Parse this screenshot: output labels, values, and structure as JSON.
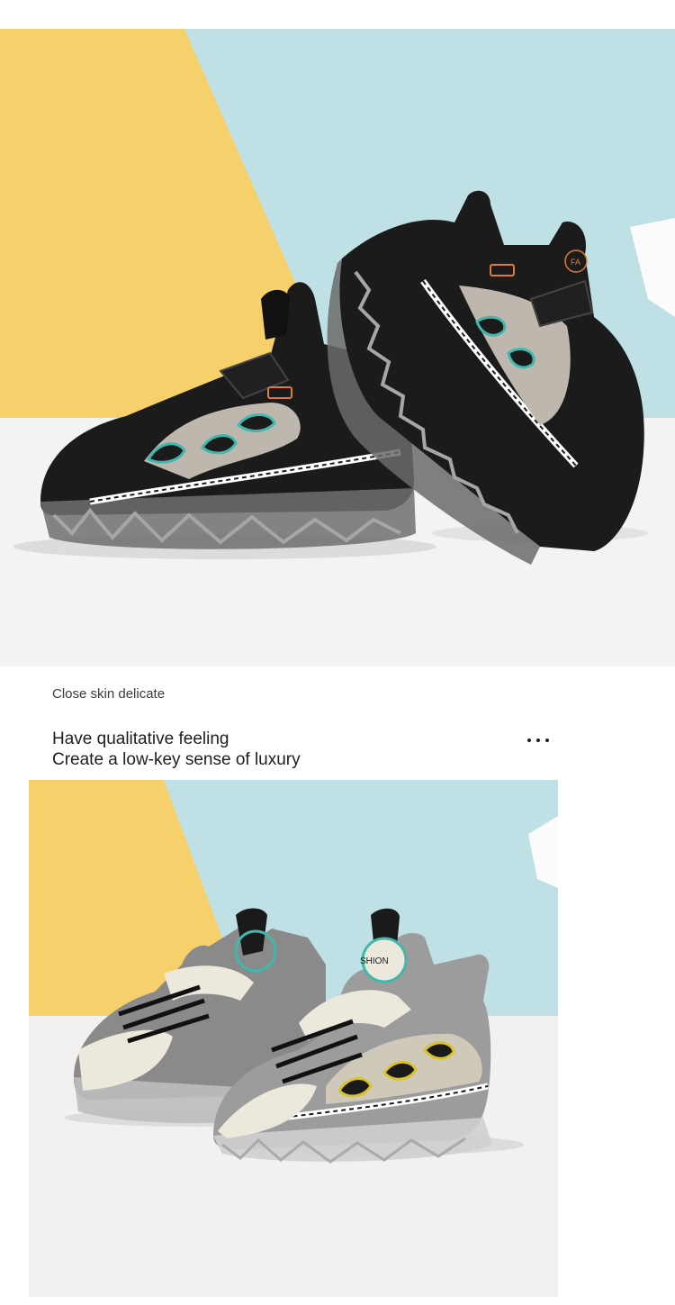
{
  "caption": "Close skin delicate",
  "headline": {
    "line1": "Have qualitative feeling",
    "line2": "Create a low-key sense of luxury"
  },
  "more_icon": "more-dots-icon",
  "photos": {
    "hero": {
      "subject": "black-kids-sneakers",
      "tongue_text": "FA"
    },
    "detail": {
      "subject": "white-grey-kids-sneakers",
      "tongue_text": "SHION"
    }
  },
  "colors": {
    "yellow_bg": "#f6d06b",
    "blue_bg": "#bfe1e6",
    "floor": "#f2f1ef",
    "accent_teal": "#3fb8ad",
    "accent_yellow": "#d9c22d",
    "accent_orange": "#e07a3a"
  }
}
